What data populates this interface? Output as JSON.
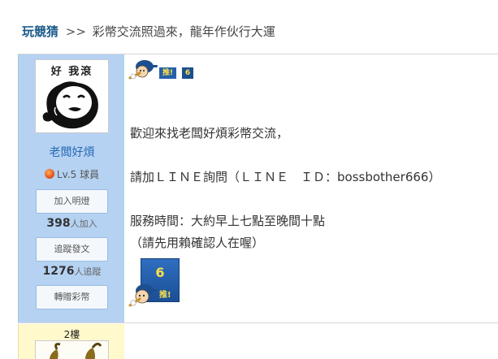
{
  "breadcrumb": {
    "home": "玩競猜",
    "separator": ">>",
    "title": "彩幣交流照過來，龍年作伙行大運"
  },
  "author": {
    "avatar_text": "好 我滾",
    "username": "老闆好煩",
    "level": "Lv.5",
    "rank": "球員",
    "follow_button": "加入明燈",
    "follow_count": "398",
    "follow_suffix": "人加入",
    "track_button": "追蹤發文",
    "track_count": "1276",
    "track_suffix": "人追蹤",
    "gift_button": "轉贈彩幣"
  },
  "post": {
    "push_label": "推!",
    "push_count": "6",
    "lines": [
      "歡迎來找老闆好煩彩幣交流，",
      "請加ＬＩＮＥ詢問（ＬＩＮＥ　ＩＤ：bossbother666）",
      "服務時間：大約早上七點至晚間十點",
      "（請先用賴確認人在喔）"
    ]
  },
  "next_post": {
    "floor": "2樓"
  },
  "colors": {
    "sidebar_bg": "#b5d2f2",
    "username": "#2a6bb5",
    "push_badge": "#2560a8",
    "push_text": "#ffe14a",
    "floor_bg": "#fff9cc"
  },
  "icons": {
    "level_badge": "orange-ball-icon",
    "mascot": "baseball-mascot-icon"
  }
}
